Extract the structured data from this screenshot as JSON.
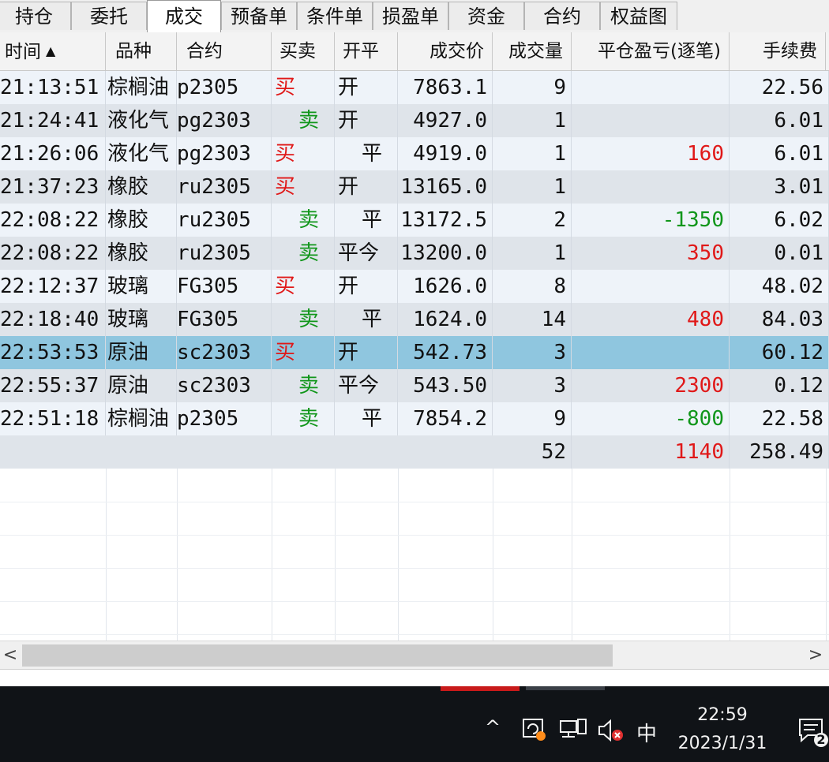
{
  "tabs": [
    {
      "label": "持仓"
    },
    {
      "label": "委托"
    },
    {
      "label": "成交"
    },
    {
      "label": "预备单"
    },
    {
      "label": "条件单"
    },
    {
      "label": "损盈单"
    },
    {
      "label": "资金"
    },
    {
      "label": "合约"
    },
    {
      "label": "权益图"
    }
  ],
  "active_tab": "成交",
  "columns": {
    "time": "时间",
    "product": "品种",
    "contract": "合约",
    "side": "买卖",
    "openclose": "开平",
    "price": "成交价",
    "volume": "成交量",
    "pnl": "平仓盈亏(逐笔)",
    "fee": "手续费"
  },
  "sort_indicator": "▲",
  "rows": [
    {
      "time": "21:13:51",
      "product": "棕榈油",
      "contract": "p2305",
      "side": "买",
      "openclose": "开",
      "price": "7863.1",
      "volume": "9",
      "pnl": "",
      "fee": "22.56"
    },
    {
      "time": "21:24:41",
      "product": "液化气",
      "contract": "pg2303",
      "side": "卖",
      "openclose": "开",
      "price": "4927.0",
      "volume": "1",
      "pnl": "",
      "fee": "6.01"
    },
    {
      "time": "21:26:06",
      "product": "液化气",
      "contract": "pg2303",
      "side": "买",
      "openclose": "平",
      "price": "4919.0",
      "volume": "1",
      "pnl": "160",
      "fee": "6.01"
    },
    {
      "time": "21:37:23",
      "product": "橡胶",
      "contract": "ru2305",
      "side": "买",
      "openclose": "开",
      "price": "13165.0",
      "volume": "1",
      "pnl": "",
      "fee": "3.01"
    },
    {
      "time": "22:08:22",
      "product": "橡胶",
      "contract": "ru2305",
      "side": "卖",
      "openclose": "平",
      "price": "13172.5",
      "volume": "2",
      "pnl": "-1350",
      "fee": "6.02"
    },
    {
      "time": "22:08:22",
      "product": "橡胶",
      "contract": "ru2305",
      "side": "卖",
      "openclose": "平今",
      "price": "13200.0",
      "volume": "1",
      "pnl": "350",
      "fee": "0.01"
    },
    {
      "time": "22:12:37",
      "product": "玻璃",
      "contract": "FG305",
      "side": "买",
      "openclose": "开",
      "price": "1626.0",
      "volume": "8",
      "pnl": "",
      "fee": "48.02"
    },
    {
      "time": "22:18:40",
      "product": "玻璃",
      "contract": "FG305",
      "side": "卖",
      "openclose": "平",
      "price": "1624.0",
      "volume": "14",
      "pnl": "480",
      "fee": "84.03"
    },
    {
      "time": "22:53:53",
      "product": "原油",
      "contract": "sc2303",
      "side": "买",
      "openclose": "开",
      "price": "542.73",
      "volume": "3",
      "pnl": "",
      "fee": "60.12"
    },
    {
      "time": "22:55:37",
      "product": "原油",
      "contract": "sc2303",
      "side": "卖",
      "openclose": "平今",
      "price": "543.50",
      "volume": "3",
      "pnl": "2300",
      "fee": "0.12"
    },
    {
      "time": "22:51:18",
      "product": "棕榈油",
      "contract": "p2305",
      "side": "卖",
      "openclose": "平",
      "price": "7854.2",
      "volume": "9",
      "pnl": "-800",
      "fee": "22.58"
    }
  ],
  "selected_row_index": 8,
  "totals": {
    "volume": "52",
    "pnl": "1140",
    "fee": "258.49"
  },
  "colors": {
    "buy": "#e01818",
    "sell": "#10961a",
    "profit": "#e01818",
    "loss": "#10961a",
    "selected_row": "#8fc6df"
  },
  "scrollbar": {
    "left_arrow": "<",
    "right_arrow": ">"
  },
  "taskbar": {
    "tray_up": "^",
    "ime": "中",
    "time": "22:59",
    "date": "2023/1/31",
    "notification_count": "2"
  }
}
